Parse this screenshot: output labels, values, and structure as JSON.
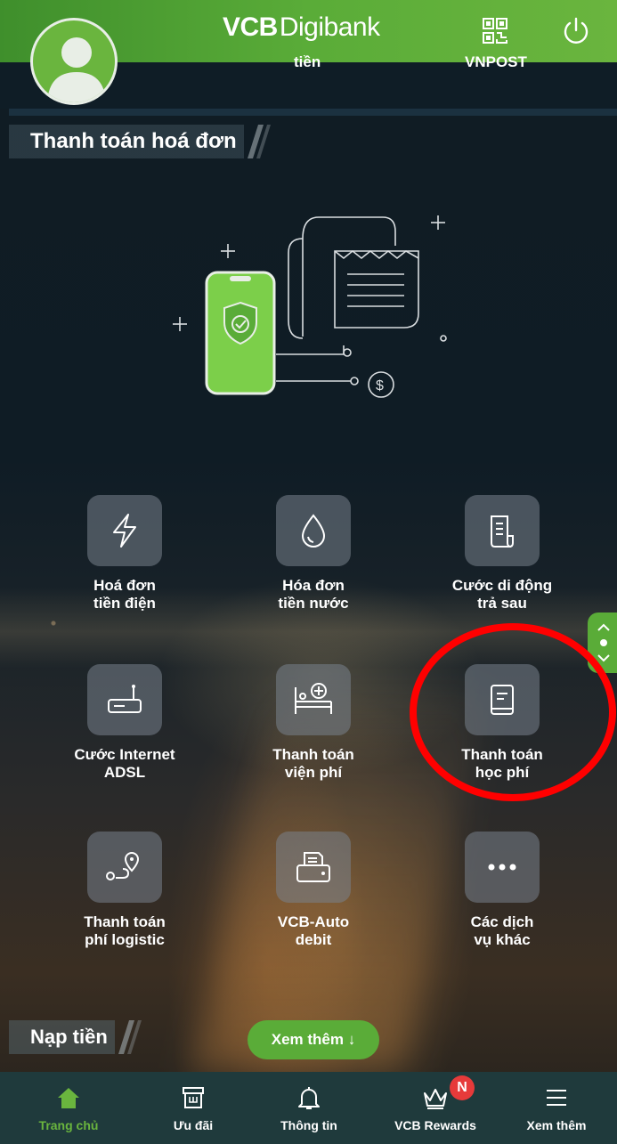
{
  "header": {
    "logo_bold": "VCB",
    "logo_light": "Digibank"
  },
  "top_strip": {
    "left_label": "tiền",
    "right_label": "VNPOST"
  },
  "section": {
    "title": "Thanh toán hoá đơn"
  },
  "services": [
    {
      "label": "Hoá đơn\ntiền điện",
      "icon": "lightning-icon"
    },
    {
      "label": "Hóa đơn\ntiền nước",
      "icon": "water-drop-icon"
    },
    {
      "label": "Cước di động\ntrả sau",
      "icon": "bill-icon"
    },
    {
      "label": "Cước Internet\nADSL",
      "icon": "router-icon"
    },
    {
      "label": "Thanh toán\nviện phí",
      "icon": "hospital-bed-icon"
    },
    {
      "label": "Thanh toán\nhọc phí",
      "icon": "book-icon"
    },
    {
      "label": "Thanh toán\nphí logistic",
      "icon": "location-route-icon"
    },
    {
      "label": "VCB-Auto\ndebit",
      "icon": "printer-icon"
    },
    {
      "label": "Các dịch\nvụ khác",
      "icon": "more-dots-icon"
    }
  ],
  "deposit": {
    "title": "Nạp tiền",
    "more_button": "Xem thêm ↓"
  },
  "tabbar": {
    "tabs": [
      {
        "label": "Trang chủ",
        "icon": "home-icon",
        "active": true
      },
      {
        "label": "Ưu đãi",
        "icon": "gift-box-icon",
        "active": false
      },
      {
        "label": "Thông tin",
        "icon": "bell-icon",
        "active": false
      },
      {
        "label": "VCB Rewards",
        "icon": "crown-icon",
        "active": false
      },
      {
        "label": "Xem thêm",
        "icon": "menu-icon",
        "active": false
      }
    ],
    "rewards_badge": "N"
  },
  "colors": {
    "brand_green": "#5aac38",
    "highlight_red": "#ff0000"
  }
}
